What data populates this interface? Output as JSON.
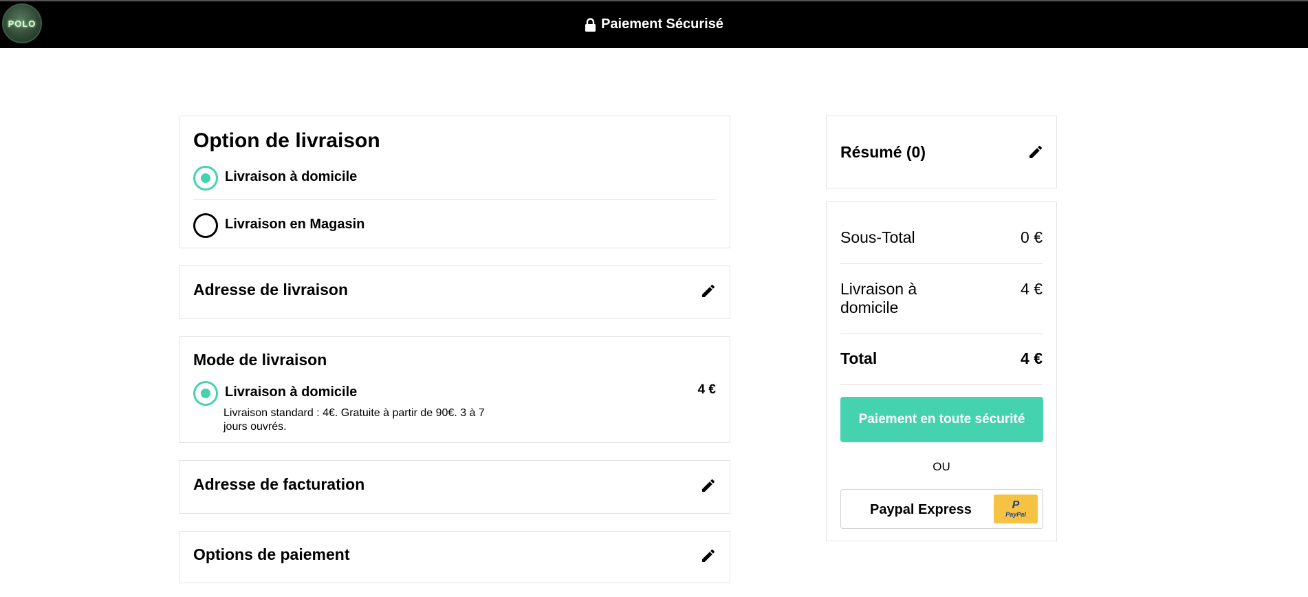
{
  "header": {
    "logo_text": "POLO",
    "title": "Paiement Sécurisé",
    "lock_icon": "lock-icon"
  },
  "delivery_option": {
    "title": "Option de livraison",
    "options": [
      {
        "label": "Livraison à domicile",
        "selected": true
      },
      {
        "label": "Livraison en Magasin",
        "selected": false
      }
    ]
  },
  "shipping_address": {
    "title": "Adresse de livraison",
    "icon": "pencil-icon"
  },
  "delivery_mode": {
    "title": "Mode de livraison",
    "option_label": "Livraison à domicile",
    "price": "4 €",
    "description_line1": "Livraison standard : 4€. Gratuite à partir de 90€. 3 à 7",
    "description_line2": "jours ouvrés."
  },
  "billing_address": {
    "title": "Adresse de facturation",
    "icon": "pencil-icon"
  },
  "payment_options": {
    "title": "Options de paiement",
    "icon": "pencil-icon"
  },
  "summary": {
    "title": "Résumé (0)",
    "icon": "pencil-icon",
    "subtotal_label": "Sous-Total",
    "subtotal_value": "0 €",
    "shipping_label": "Livraison à domicile",
    "shipping_value": "4 €",
    "total_label": "Total",
    "total_value": "4 €",
    "pay_button": "Paiement en toute sécurité",
    "or_text": "OU",
    "paypal_label": "Paypal Express",
    "paypal_badge_p": "P",
    "paypal_badge_word": "PayPal"
  },
  "colors": {
    "accent": "#44d3ae",
    "header_bg": "#000000",
    "paypal_yellow": "#f5c243"
  }
}
